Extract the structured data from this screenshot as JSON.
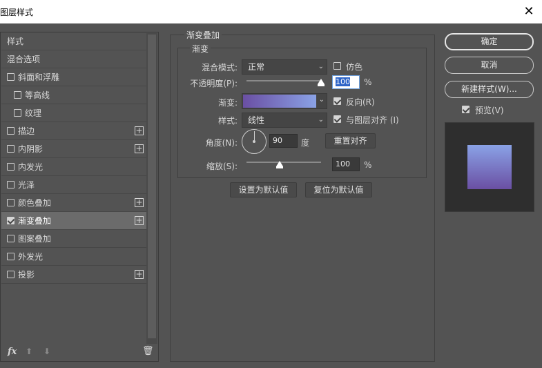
{
  "window": {
    "title": "图层样式",
    "close_icon": "close-icon"
  },
  "sidebar": {
    "header": "样式",
    "blend_options": "混合选项",
    "items": [
      {
        "label": "斜面和浮雕",
        "checked": false,
        "plus": false,
        "indent": false
      },
      {
        "label": "等高线",
        "checked": false,
        "plus": false,
        "indent": true
      },
      {
        "label": "纹理",
        "checked": false,
        "plus": false,
        "indent": true
      },
      {
        "label": "描边",
        "checked": false,
        "plus": true,
        "indent": false
      },
      {
        "label": "内阴影",
        "checked": false,
        "plus": true,
        "indent": false
      },
      {
        "label": "内发光",
        "checked": false,
        "plus": false,
        "indent": false
      },
      {
        "label": "光泽",
        "checked": false,
        "plus": false,
        "indent": false
      },
      {
        "label": "颜色叠加",
        "checked": false,
        "plus": true,
        "indent": false
      },
      {
        "label": "渐变叠加",
        "checked": true,
        "plus": true,
        "indent": false,
        "active": true
      },
      {
        "label": "图案叠加",
        "checked": false,
        "plus": false,
        "indent": false
      },
      {
        "label": "外发光",
        "checked": false,
        "plus": false,
        "indent": false
      },
      {
        "label": "投影",
        "checked": false,
        "plus": true,
        "indent": false
      }
    ],
    "footer": {
      "fx": "fx",
      "up_icon": "arrow-up-icon",
      "down_icon": "arrow-down-icon",
      "trash_icon": "trash-icon"
    }
  },
  "panel": {
    "section_title": "渐变叠加",
    "group_title": "渐变",
    "blend_mode": {
      "label": "混合模式:",
      "value": "正常"
    },
    "dither": {
      "label": "仿色",
      "checked": false
    },
    "opacity": {
      "label": "不透明度(P):",
      "value": "100",
      "unit": "%",
      "slider_fraction": 1.0
    },
    "gradient": {
      "label": "渐变:",
      "color_start": "#6a4fa3",
      "color_end": "#8aa2e6"
    },
    "reverse": {
      "label": "反向(R)",
      "checked": true
    },
    "style": {
      "label": "样式:",
      "value": "线性"
    },
    "align_layer": {
      "label": "与图层对齐 (I)",
      "checked": true
    },
    "angle": {
      "label": "角度(N):",
      "value": "90",
      "unit": "度",
      "reset_label": "重置对齐"
    },
    "scale": {
      "label": "缩放(S):",
      "value": "100",
      "unit": "%",
      "slider_fraction": 0.44
    },
    "make_default": "设置为默认值",
    "reset_default": "复位为默认值"
  },
  "buttons": {
    "ok": "确定",
    "cancel": "取消",
    "new_style": "新建样式(W)...",
    "preview": {
      "label": "预览(V)",
      "checked": true
    }
  },
  "preview_colors": {
    "top": "#8aa2e6",
    "bottom": "#6a4fa3"
  }
}
